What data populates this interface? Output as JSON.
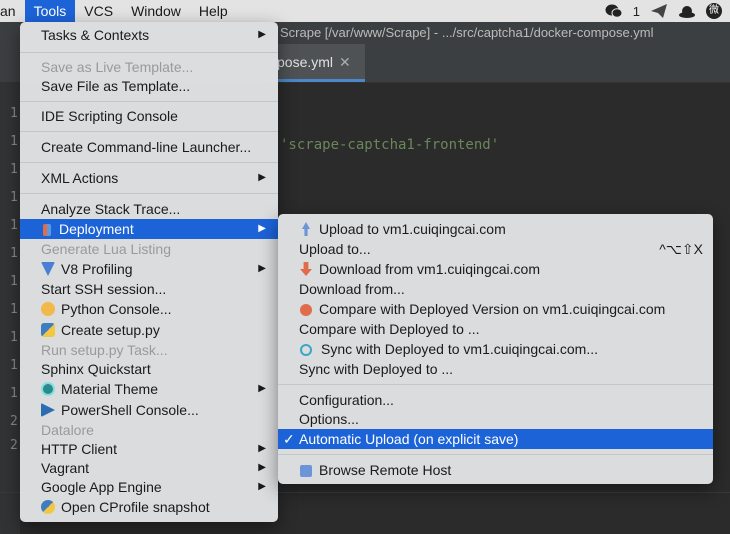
{
  "menubar": {
    "items": [
      {
        "label": "an"
      },
      {
        "label": "Tools"
      },
      {
        "label": "VCS"
      },
      {
        "label": "Window"
      },
      {
        "label": "Help"
      }
    ],
    "tray_count": "1",
    "tray_badge": "微"
  },
  "window": {
    "title": "Scrape [/var/www/Scrape] - .../src/captcha1/docker-compose.yml"
  },
  "editor": {
    "tab_label": "pose.yml",
    "code_lines": [
      "'scrape-captcha1-frontend'"
    ],
    "line_numbers": [
      "1",
      "1",
      "1",
      "1",
      "1",
      "1",
      "1",
      "1",
      "1",
      "1",
      "1",
      "2",
      "2"
    ]
  },
  "tools_menu": {
    "items": [
      {
        "label": "Tasks & Contexts"
      },
      {
        "label": "Save as Live Template..."
      },
      {
        "label": "Save File as Template..."
      },
      {
        "label": "IDE Scripting Console"
      },
      {
        "label": "Create Command-line Launcher..."
      },
      {
        "label": "XML Actions"
      },
      {
        "label": "Analyze Stack Trace..."
      },
      {
        "label": "Deployment"
      },
      {
        "label": "Generate Lua Listing"
      },
      {
        "label": "V8 Profiling"
      },
      {
        "label": "Start SSH session..."
      },
      {
        "label": "Python Console..."
      },
      {
        "label": "Create setup.py"
      },
      {
        "label": "Run setup.py Task..."
      },
      {
        "label": "Sphinx Quickstart"
      },
      {
        "label": "Material Theme"
      },
      {
        "label": "PowerShell Console..."
      },
      {
        "label": "Datalore"
      },
      {
        "label": "HTTP Client"
      },
      {
        "label": "Vagrant"
      },
      {
        "label": "Google App Engine"
      },
      {
        "label": "Open CProfile snapshot"
      }
    ]
  },
  "deployment_menu": {
    "items": [
      {
        "label": "Upload to vm1.cuiqingcai.com"
      },
      {
        "label": "Upload to...",
        "shortcut": "^⌥⇧X"
      },
      {
        "label": "Download from vm1.cuiqingcai.com"
      },
      {
        "label": "Download from..."
      },
      {
        "label": "Compare with Deployed Version on vm1.cuiqingcai.com"
      },
      {
        "label": "Compare with Deployed to ..."
      },
      {
        "label": "Sync with Deployed to vm1.cuiqingcai.com..."
      },
      {
        "label": "Sync with Deployed to ..."
      },
      {
        "label": "Configuration..."
      },
      {
        "label": "Options..."
      },
      {
        "label": "Automatic Upload (on explicit save)",
        "checked": true
      },
      {
        "label": "Browse Remote Host"
      }
    ]
  },
  "colors": {
    "highlight": "#1d63d8",
    "menu_bg": "#e0e2e4",
    "editor_bg": "#2b2b2b"
  }
}
